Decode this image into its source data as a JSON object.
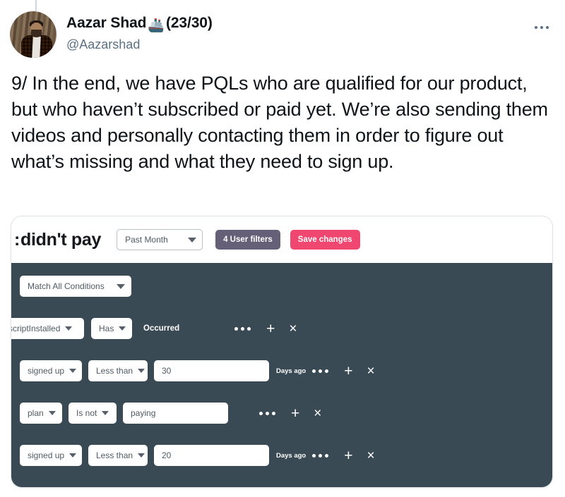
{
  "tweet": {
    "display_name": "Aazar Shad",
    "name_emoji": "🚢",
    "name_suffix": "(23/30)",
    "handle": "@Aazarshad",
    "body": "9/ In the end, we have PQLs who are qualified for our product, but who haven’t subscribed or paid yet. We’re also sending them videos and personally contacting them in order to figure out what’s missing and what they need to sign up.",
    "more_menu_icon": "ellipsis-horizontal-icon",
    "avatar_alt": "profile-photo"
  },
  "embedded_app": {
    "topbar": {
      "title_clipped_prefix": ":",
      "title": "didn't pay",
      "period_select": {
        "value": "Past Month",
        "caret_icon": "chevron-down-icon"
      },
      "user_filters_label": "4 User filters",
      "user_filters_color": "#655f77",
      "save_changes_label": "Save changes",
      "save_changes_color": "#ef476f"
    },
    "panel": {
      "background_color": "#3a4a54",
      "match_conditions": {
        "value": "Match All Conditions",
        "caret_icon": "chevron-down-icon"
      },
      "rows": [
        {
          "attribute": "scriptInstalled",
          "operator": "Has",
          "static_word": "Occurred",
          "value": null,
          "value_placeholder": null,
          "unit": null,
          "more_icon": "ellipsis-horizontal-icon",
          "add_icon": "plus-icon",
          "remove_icon": "close-icon"
        },
        {
          "attribute": "signed up",
          "operator": "Less than",
          "static_word": null,
          "value": "30",
          "value_placeholder": "30",
          "unit": "Days ago",
          "more_icon": "ellipsis-horizontal-icon",
          "add_icon": "plus-icon",
          "remove_icon": "close-icon"
        },
        {
          "attribute": "plan",
          "operator": "Is not",
          "static_word": null,
          "value": "paying",
          "value_placeholder": "paying",
          "unit": null,
          "more_icon": "ellipsis-horizontal-icon",
          "add_icon": "plus-icon",
          "remove_icon": "close-icon"
        },
        {
          "attribute": "signed up",
          "operator": "Less than",
          "static_word": null,
          "value": "20",
          "value_placeholder": "20",
          "unit": "Days ago",
          "more_icon": "ellipsis-horizontal-icon",
          "add_icon": "plus-icon",
          "remove_icon": "close-icon"
        }
      ]
    }
  },
  "glyphs": {
    "plus": "+",
    "close": "×"
  }
}
